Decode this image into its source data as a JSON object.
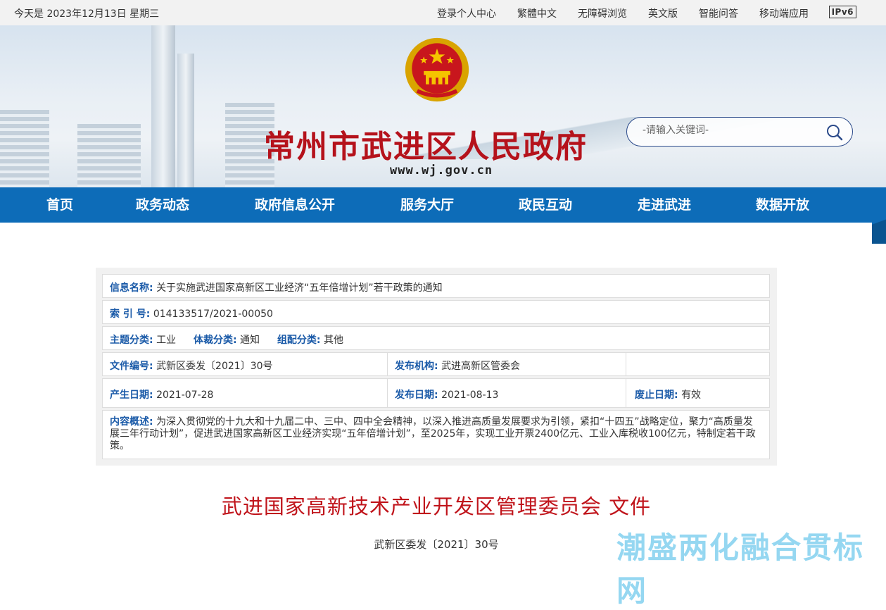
{
  "topbar": {
    "date": "今天是 2023年12月13日 星期三",
    "links": [
      "登录个人中心",
      "繁體中文",
      "无障碍浏览",
      "英文版",
      "智能问答",
      "移动端应用"
    ],
    "ipv6": "IPv6"
  },
  "header": {
    "site_name": "常州市武进区人民政府",
    "site_url": "www.wj.gov.cn",
    "search_placeholder": "-请输入关键词-"
  },
  "nav": {
    "items": [
      "首页",
      "政务动态",
      "政府信息公开",
      "服务大厅",
      "政民互动",
      "走进武进",
      "数据开放"
    ]
  },
  "info": {
    "name_label": "信息名称:",
    "name_value": "关于实施武进国家高新区工业经济“五年倍增计划”若干政策的通知",
    "index_label": "索 引 号:",
    "index_value": "014133517/2021-00050",
    "topic_label": "主题分类:",
    "topic_value": "工业",
    "genre_label": "体裁分类:",
    "genre_value": "通知",
    "org_cat_label": "组配分类:",
    "org_cat_value": "其他",
    "docno_label": "文件编号:",
    "docno_value": "武新区委发〔2021〕30号",
    "publisher_label": "发布机构:",
    "publisher_value": "武进高新区管委会",
    "created_label": "产生日期:",
    "created_value": "2021-07-28",
    "published_label": "发布日期:",
    "published_value": "2021-08-13",
    "abolish_label": "废止日期:",
    "abolish_value": "有效",
    "summary_label": "内容概述:",
    "summary_value": "为深入贯彻党的十九大和十九届二中、三中、四中全会精神，以深入推进高质量发展要求为引领，紧扣“十四五”战略定位，聚力“高质量发展三年行动计划”，促进武进国家高新区工业经济实现“五年倍增计划”，至2025年，实现工业开票2400亿元、工业入库税收100亿元，特制定若干政策。"
  },
  "document": {
    "title": "武进国家高新技术产业开发区管理委员会 文件",
    "number": "武新区委发〔2021〕30号"
  },
  "watermark": "潮盛两化融合贯标网",
  "colors": {
    "brand_red": "#b5121b",
    "nav_blue": "#0d6cb8",
    "label_blue": "#1a5aa8"
  }
}
